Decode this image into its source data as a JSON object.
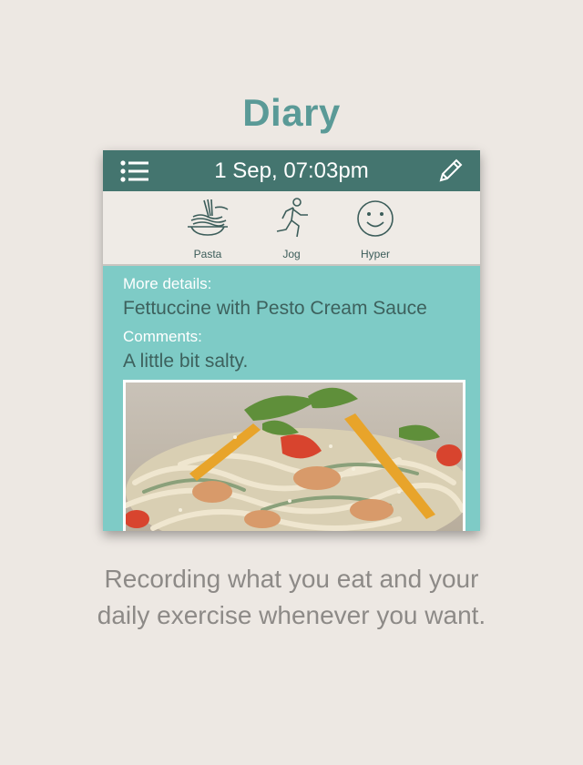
{
  "page": {
    "title": "Diary",
    "caption_line1": "Recording what you eat and your",
    "caption_line2": "daily exercise whenever you want."
  },
  "header": {
    "datetime": "1 Sep, 07:03pm",
    "menu_icon": "list-menu-icon",
    "edit_icon": "pencil-icon"
  },
  "activities": [
    {
      "label": "Pasta",
      "icon": "pasta-icon"
    },
    {
      "label": "Jog",
      "icon": "running-person-icon"
    },
    {
      "label": "Hyper",
      "icon": "smiley-face-icon"
    }
  ],
  "entry": {
    "details_label": "More details:",
    "details_value": "Fettuccine with Pesto Cream Sauce",
    "comments_label": "Comments:",
    "comments_value": "A little bit salty."
  },
  "colors": {
    "accent": "#5a9a97",
    "topbar": "#44756f",
    "panel": "#7ecbc6",
    "background": "#ede8e3"
  }
}
